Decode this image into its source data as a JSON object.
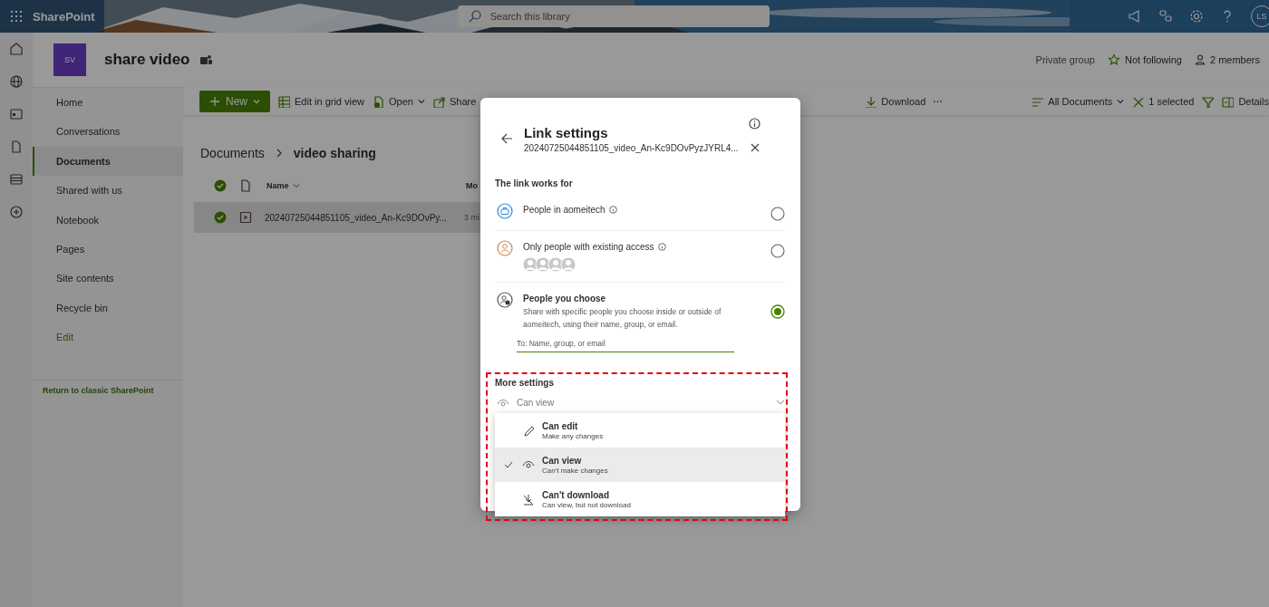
{
  "suite_bar": {
    "app_name": "SharePoint",
    "search": {
      "placeholder": "Search this library"
    },
    "avatar": "LS"
  },
  "site": {
    "logo": "SV",
    "title": "share video",
    "privacy": "Private group",
    "follow": "Not following",
    "members": "2 members"
  },
  "nav": [
    {
      "label": "Home",
      "kind": "page",
      "selected": false
    },
    {
      "label": "Conversations",
      "kind": "page",
      "selected": false
    },
    {
      "label": "Documents",
      "kind": "page",
      "selected": true
    },
    {
      "label": "Shared with us",
      "kind": "page",
      "selected": false
    },
    {
      "label": "Notebook",
      "kind": "page",
      "selected": false
    },
    {
      "label": "Pages",
      "kind": "page",
      "selected": false
    },
    {
      "label": "Site contents",
      "kind": "page",
      "selected": false
    },
    {
      "label": "Recycle bin",
      "kind": "page",
      "selected": false
    },
    {
      "label": "Edit",
      "kind": "action",
      "selected": false
    }
  ],
  "return_link": "Return to classic SharePoint",
  "toolbar": {
    "commands": [
      {
        "label": "New",
        "kind": "primary"
      },
      {
        "label": "Edit in grid view",
        "kind": "grid"
      },
      {
        "label": "Open",
        "kind": "open"
      },
      {
        "label": "Share",
        "kind": "share"
      }
    ],
    "after_dialog": [
      {
        "label": "Download",
        "kind": "download"
      },
      {
        "label": "···",
        "kind": "more"
      }
    ],
    "view": [
      {
        "label": "All Documents",
        "kind": "views"
      },
      {
        "label": "1 selected",
        "kind": "clear"
      },
      {
        "kind": "filter"
      },
      {
        "label": "Details",
        "kind": "details"
      }
    ]
  },
  "breadcrumb": [
    "Documents",
    "video sharing"
  ],
  "list": {
    "select_all": true,
    "columns": [
      "Name",
      "Mo"
    ],
    "rows": [
      {
        "name": "20240725044851105_video_An-Kc9DOvPy...",
        "modified": "3 mi",
        "selected": true
      }
    ]
  },
  "dialog": {
    "title": "Link settings",
    "subtitle": "20240725044851105_video_An-Kc9DOvPyzJYRL4...",
    "section": "The link works for",
    "options": [
      {
        "kind": "org",
        "label": "People in aomeitech",
        "selected": false
      },
      {
        "kind": "existing",
        "label": "Only people with existing access",
        "selected": false
      },
      {
        "kind": "specific",
        "label": "People you choose",
        "description": "Share with specific people you choose inside or outside of aomeitech, using their name, group, or email.",
        "placeholder": "To: Name, group, or email",
        "selected": true
      }
    ],
    "more_settings": {
      "label": "More settings",
      "permission": "Can view",
      "expanded": true,
      "menu": [
        {
          "kind": "edit",
          "title": "Can edit",
          "description": "Make any changes",
          "selected": false
        },
        {
          "kind": "view",
          "title": "Can view",
          "description": "Can't make changes",
          "selected": true
        },
        {
          "kind": "nodownload",
          "title": "Can't download",
          "description": "Can view, but not download",
          "selected": false
        }
      ]
    }
  }
}
